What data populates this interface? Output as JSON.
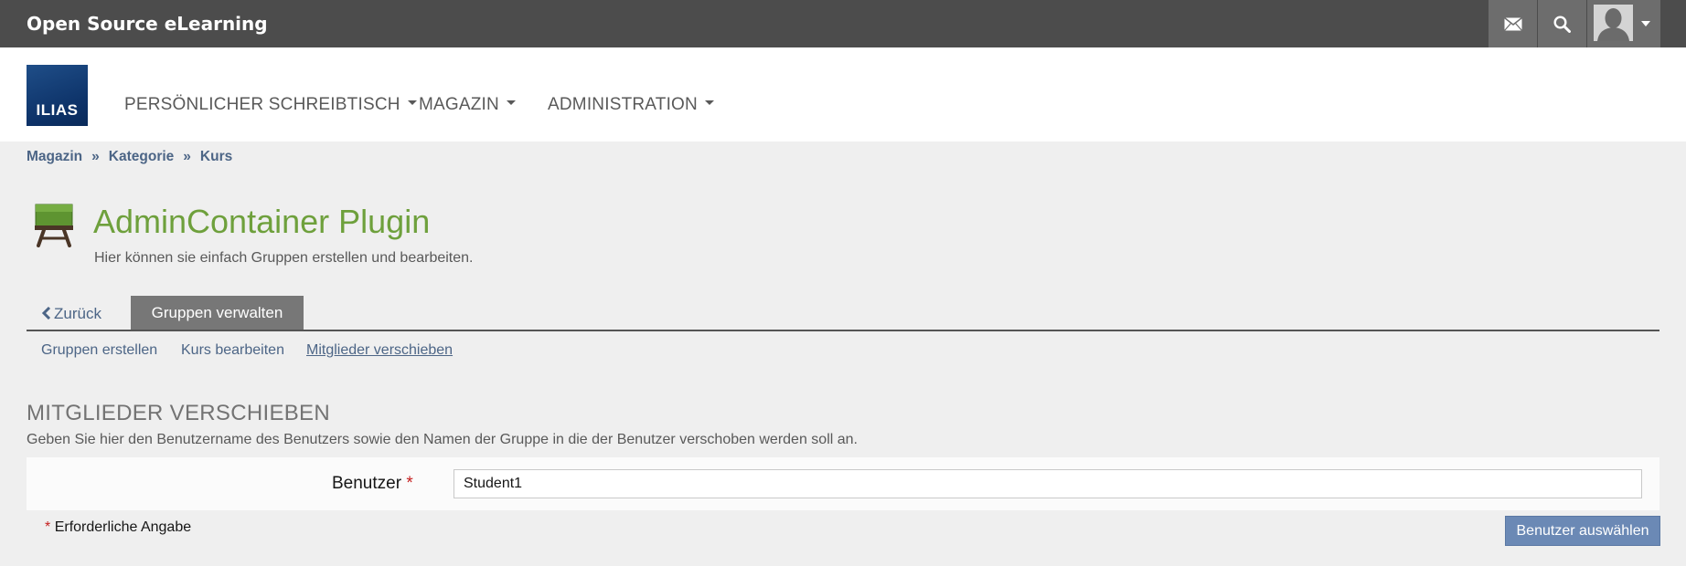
{
  "topbar": {
    "title": "Open Source eLearning",
    "icons": [
      "mail-icon",
      "search-icon",
      "user-avatar-icon"
    ]
  },
  "header": {
    "logo_text": "ILIAS",
    "nav": [
      {
        "label": "PERSÖNLICHER SCHREIBTISCH"
      },
      {
        "label": "MAGAZIN"
      },
      {
        "label": "ADMINISTRATION"
      }
    ]
  },
  "breadcrumb": {
    "items": [
      "Magazin",
      "Kategorie",
      "Kurs"
    ],
    "separator": "»"
  },
  "page": {
    "title": "AdminContainer Plugin",
    "description": "Hier können sie einfach Gruppen erstellen und bearbeiten.",
    "title_color": "#6ea03c"
  },
  "tabs": {
    "back_label": "Zurück",
    "active_label": "Gruppen verwalten",
    "subtabs": [
      "Gruppen erstellen",
      "Kurs bearbeiten",
      "Mitglieder verschieben"
    ],
    "active_subtab": "Mitglieder verschieben"
  },
  "form": {
    "section_title": "MITGLIEDER VERSCHIEBEN",
    "section_description": "Geben Sie hier den Benutzername des Benutzers sowie den Namen der Gruppe in die der Benutzer verschoben werden soll an.",
    "field_label": "Benutzer",
    "required_marker": "*",
    "field_value": "Student1",
    "required_note": "Erforderliche Angabe",
    "submit_label": "Benutzer auswählen"
  },
  "colors": {
    "topbar": "#4c4c4c",
    "link": "#4c6586",
    "primary_button": "#6b89b5",
    "required": "#c52020"
  }
}
